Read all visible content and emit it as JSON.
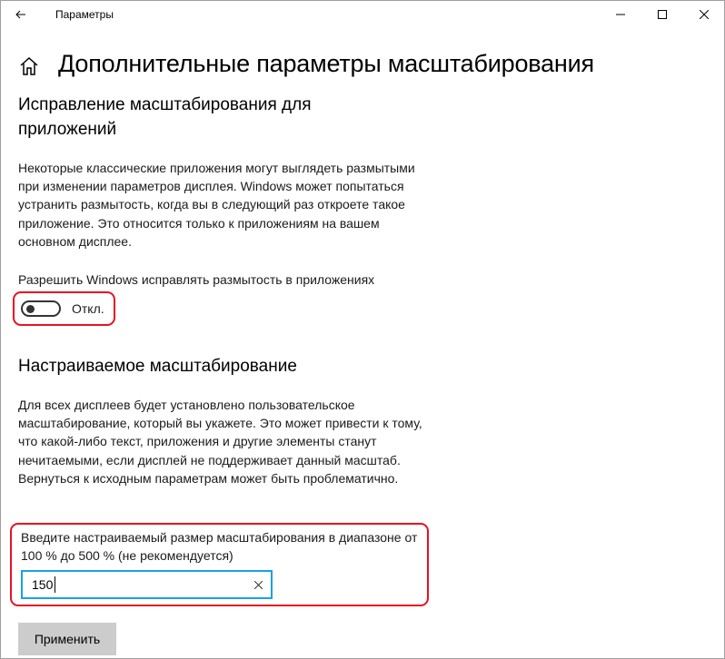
{
  "window": {
    "title": "Параметры",
    "controls": [
      "minimize-icon",
      "maximize-icon",
      "close-icon"
    ]
  },
  "header": {
    "home_icon": "home-icon",
    "title": "Дополнительные параметры масштабирования"
  },
  "section_fix": {
    "title": "Исправление масштабирования для приложений",
    "description": "Некоторые классические приложения могут выглядеть размытыми при изменении параметров дисплея. Windows может попытаться устранить размытость, когда вы в следующий раз откроете такое приложение. Это относится только к приложениям на вашем основном дисплее.",
    "toggle_label": "Разрешить Windows исправлять размытость в приложениях",
    "toggle_state_label": "Откл.",
    "toggle_on": false
  },
  "section_custom": {
    "title": "Настраиваемое масштабирование",
    "description": "Для всех дисплеев будет установлено пользовательское масштабирование, который вы укажете. Это может привести к тому, что какой-либо текст, приложения и другие элементы станут нечитаемыми, если дисплей не поддерживает данный масштаб. Вернуться к исходным параметрам может быть проблематично.",
    "input_label": "Введите настраиваемый размер масштабирования в диапазоне от 100 % до 500 % (не рекомендуется)",
    "input_value": "150",
    "apply_label": "Применить"
  },
  "colors": {
    "highlight": "#e81123",
    "input_border": "#1ba1e2",
    "button_bg": "#cccccc"
  }
}
